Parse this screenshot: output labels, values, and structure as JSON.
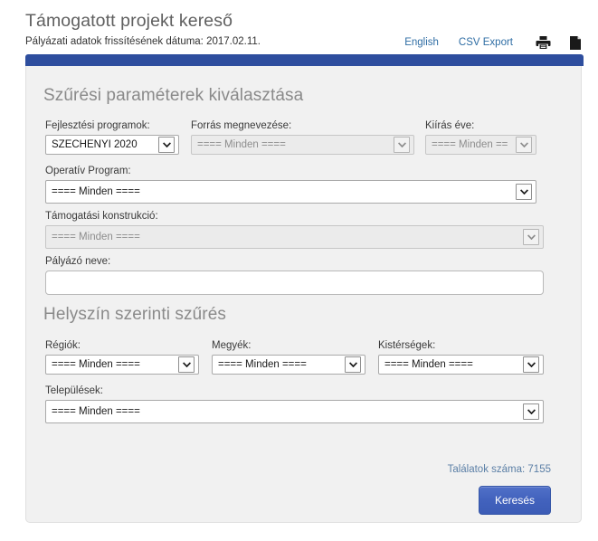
{
  "header": {
    "title": "Támogatott projekt kereső",
    "date_line": "Pályázati adatok frissítésének dátuma: 2017.02.11.",
    "english_link": "English",
    "csv_export_link": "CSV Export",
    "print_icon": "printer-icon",
    "document_icon": "document-icon"
  },
  "accent": {
    "bar_color": "#2E4E9E",
    "link_color": "#2E6DA4",
    "button_color": "#4262BD",
    "results_color": "#5B7FA6",
    "panel_bg": "#F1F1F1"
  },
  "filter_section": {
    "heading": "Szűrési paraméterek kiválasztása",
    "fields": {
      "development_programs": {
        "label": "Fejlesztési programok:",
        "value": "SZÉCHENYI 2020",
        "disabled": false
      },
      "source_name": {
        "label": "Forrás megnevezése:",
        "value": "==== Minden ====",
        "disabled": true
      },
      "call_year": {
        "label": "Kiírás éve:",
        "value": "==== Minden ==",
        "disabled": true
      },
      "operative_program": {
        "label": "Operatív Program:",
        "value": "==== Minden ====",
        "disabled": false
      },
      "support_construction": {
        "label": "Támogatási konstrukció:",
        "value": "==== Minden ====",
        "disabled": true
      },
      "applicant_name": {
        "label": "Pályázó neve:",
        "value": "",
        "placeholder": ""
      }
    }
  },
  "location_section": {
    "heading": "Helyszín szerinti szűrés",
    "fields": {
      "regions": {
        "label": "Régiók:",
        "value": "==== Minden ====",
        "disabled": false
      },
      "counties": {
        "label": "Megyék:",
        "value": "==== Minden ====",
        "disabled": false
      },
      "micro_regions": {
        "label": "Kistérségek:",
        "value": "==== Minden ====",
        "disabled": false
      },
      "settlements": {
        "label": "Települések:",
        "value": "==== Minden ====",
        "disabled": false
      }
    }
  },
  "footer": {
    "results_label": "Találatok száma: 7155",
    "search_button": "Keresés"
  }
}
